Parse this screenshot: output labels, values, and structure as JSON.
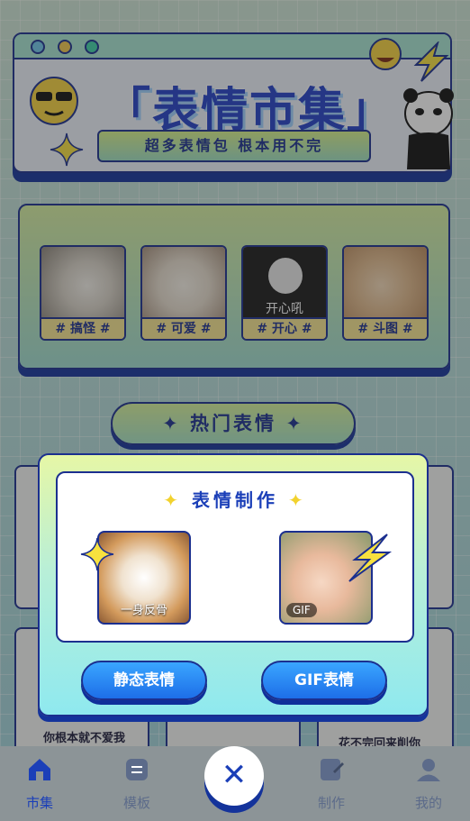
{
  "banner": {
    "title": "「表情市集」",
    "subtitle": "超多表情包 根本用不完"
  },
  "categories": [
    {
      "label": "# 搞怪 #"
    },
    {
      "label": "# 可爱 #"
    },
    {
      "label": "# 开心 #",
      "overlay_text": "开心吼"
    },
    {
      "label": "# 斗图 #"
    }
  ],
  "hot": {
    "label": "热门表情"
  },
  "background_cards": {
    "left_text": "你根本就不爱我",
    "right_text": "花不完回来削你"
  },
  "modal": {
    "title": "表情制作",
    "static_caption": "一身反骨",
    "gif_badge": "GIF",
    "static_button": "静态表情",
    "gif_button": "GIF表情"
  },
  "tabbar": {
    "items": [
      {
        "label": "市集",
        "icon": "home-icon",
        "active": true
      },
      {
        "label": "模板",
        "icon": "template-icon",
        "active": false
      },
      {
        "label": "制作",
        "icon": "edit-icon",
        "active": false
      },
      {
        "label": "我的",
        "icon": "user-icon",
        "active": false
      }
    ]
  },
  "colors": {
    "primary": "#1b3fb8",
    "outline": "#1b2f8f",
    "button": "#1d6ee8"
  }
}
